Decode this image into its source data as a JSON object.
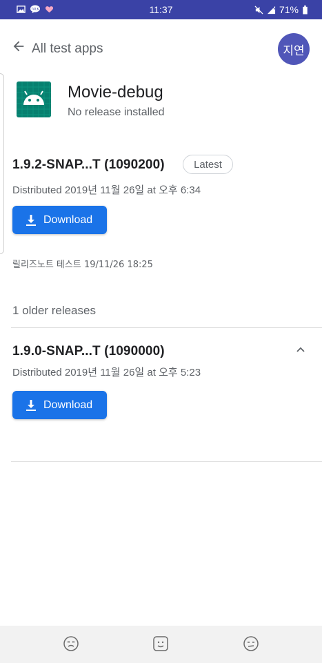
{
  "status_bar": {
    "time": "11:37",
    "battery": "71%",
    "left_icons": [
      "gallery-icon",
      "kakaotalk-icon",
      "heart-icon"
    ],
    "right_icons": [
      "mute-icon",
      "signal-icon",
      "battery-icon"
    ]
  },
  "header": {
    "back_label": "All test apps",
    "avatar_text": "지연"
  },
  "app": {
    "name": "Movie-debug",
    "status": "No release installed",
    "icon": "android-icon",
    "icon_color": "#07806f"
  },
  "latest_release": {
    "version": "1.9.2-SNAP...T (1090200)",
    "badge": "Latest",
    "distributed": "Distributed 2019년 11월 26일 at 오후 6:34",
    "download_label": "Download",
    "release_note": "릴리즈노트 테스트 19/11/26 18:25"
  },
  "older": {
    "header": "1 older releases",
    "releases": [
      {
        "version": "1.9.0-SNAP...T (1090000)",
        "distributed": "Distributed 2019년 11월 26일 at 오후 5:23",
        "download_label": "Download"
      }
    ]
  },
  "colors": {
    "status_bar": "#3a42a6",
    "avatar": "#5056b8",
    "button": "#1a73e8"
  },
  "bottom_nav": [
    "emoji-dizzy-icon",
    "emoji-smile-icon",
    "emoji-frown-icon"
  ]
}
